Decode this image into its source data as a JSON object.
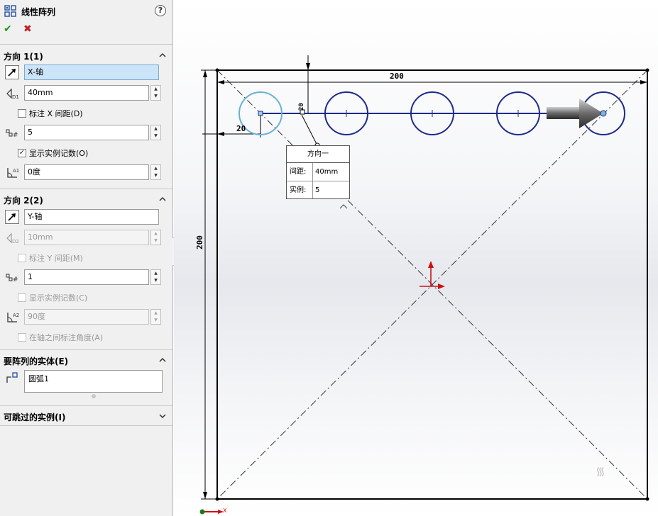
{
  "panel": {
    "title": "线性阵列",
    "help": "?",
    "ok": "✔",
    "cancel": "✖",
    "dir1": {
      "header": "方向 1(1)",
      "axis": "X-轴",
      "spacing": "40mm",
      "dim_check": "标注 X 间距(D)",
      "count": "5",
      "show_count_check": "显示实例记数(O)",
      "angle": "0度"
    },
    "dir2": {
      "header": "方向 2(2)",
      "axis": "Y-轴",
      "spacing": "10mm",
      "dim_check": "标注 Y 间距(M)",
      "count": "1",
      "show_count_check": "显示实例记数(C)",
      "angle": "90度",
      "angle_check": "在轴之间标注角度(A)"
    },
    "entities": {
      "header": "要阵列的实体(E)",
      "items": [
        "圆弧1"
      ]
    },
    "skip": {
      "header": "可跳过的实例(I)"
    },
    "icons": {
      "title": "linear-pattern-icon",
      "axis": "direction-arrow-icon",
      "spacing": "spacing-icon",
      "count": "instance-count-icon",
      "angle": "angle-icon",
      "entities": "sketch-entities-icon"
    }
  },
  "viewport": {
    "dim_top": "200",
    "dim_left": "200",
    "dim_small": "20",
    "dim_vertical_small": "20",
    "callout": {
      "title": "方向一",
      "spacing_label": "间距:",
      "spacing_value": "40mm",
      "count_label": "实例:",
      "count_value": "5"
    },
    "axis_label": "X"
  },
  "colors": {
    "accent_blue": "#1c2a8a",
    "selected_circle": "#6ab0d6",
    "field_selected": "#cce4f7",
    "origin_red": "#cc1111"
  }
}
